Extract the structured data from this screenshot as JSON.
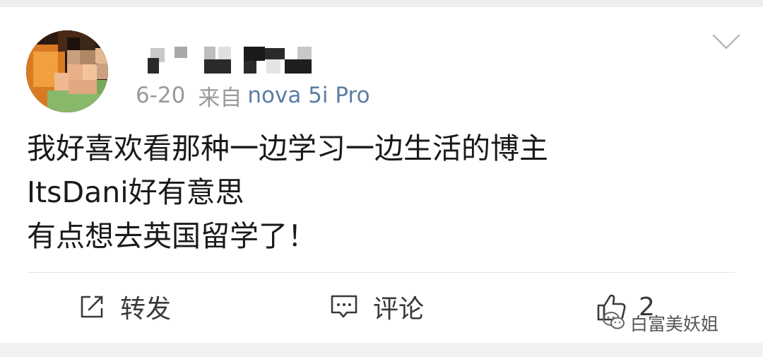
{
  "post": {
    "author_display": "",
    "date": "6-20",
    "from_label": "来自",
    "device": "nova 5i Pro",
    "lines": [
      "我好喜欢看那种一边学习一边生活的博主",
      "ItsDani好有意思",
      "有点想去英国留学了！"
    ]
  },
  "actions": {
    "repost_label": "转发",
    "comment_label": "评论",
    "like_count": "2"
  },
  "watermark": {
    "text": "白富美妖姐"
  },
  "icons": {
    "menu": "chevron-down-icon",
    "repost": "share-icon",
    "comment": "comment-icon",
    "like": "thumbs-up-icon",
    "watermark": "wechat-icon"
  },
  "colors": {
    "device_link": "#5b7ea3",
    "meta_gray": "#9a9a9a",
    "body_text": "#1a1a1a"
  }
}
